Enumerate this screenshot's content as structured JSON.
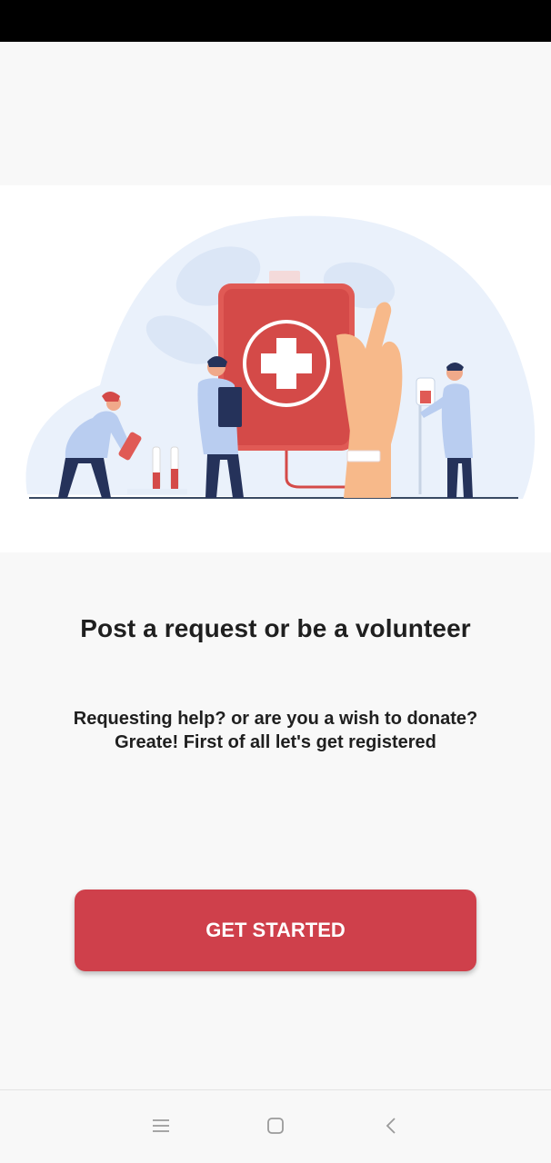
{
  "onboarding": {
    "title": "Post a request or be a volunteer",
    "subtitle_line1": "Requesting help? or are you a wish to donate?",
    "subtitle_line2": "Greate! First of all let's get registered",
    "cta_label": "GET STARTED"
  },
  "illustration": {
    "icon": "blood-donation-illustration"
  },
  "navigation_bar": {
    "items": [
      {
        "icon": "menu-icon"
      },
      {
        "icon": "home-square-icon"
      },
      {
        "icon": "back-chevron-icon"
      }
    ]
  },
  "colors": {
    "accent": "#cf404b",
    "background": "#f8f8f8",
    "blood_red": "#dd4a4a",
    "coat_blue": "#b9cdf0",
    "text": "#1f1f1f"
  }
}
